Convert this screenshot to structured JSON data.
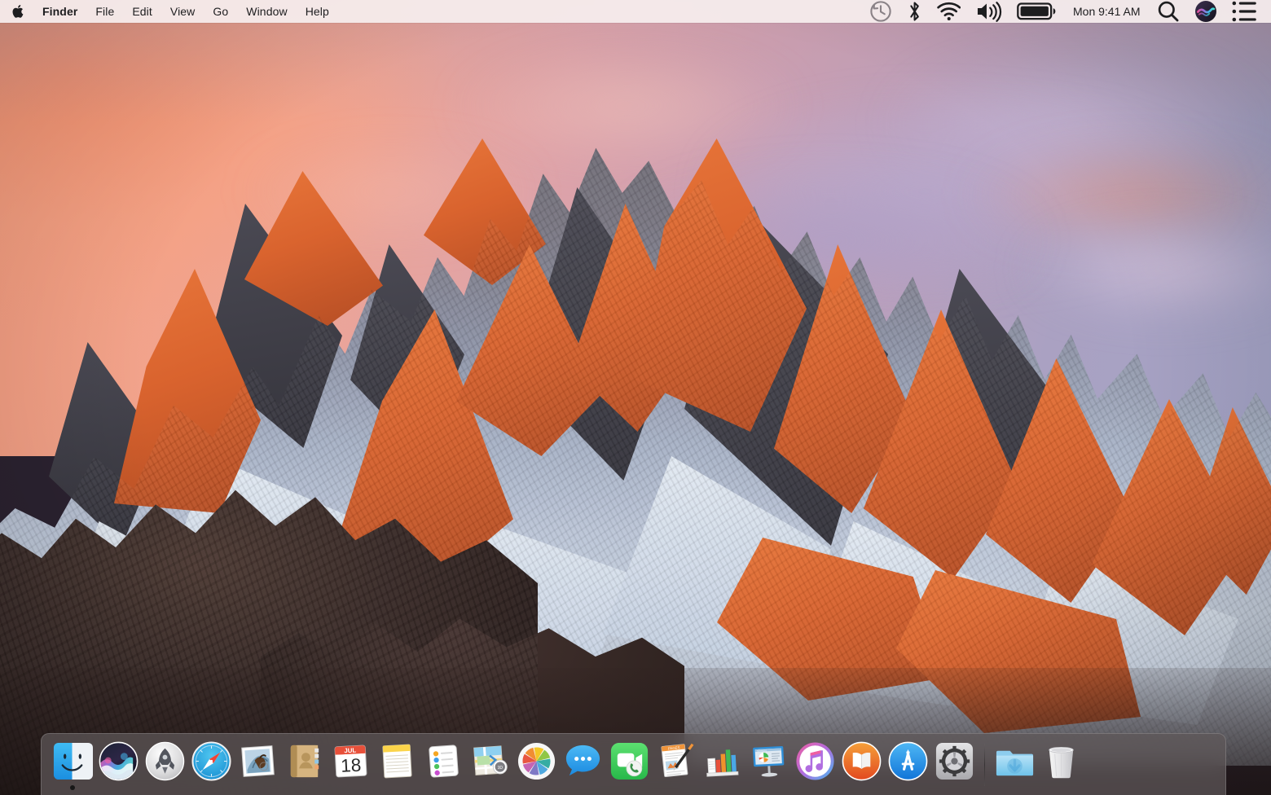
{
  "os": {
    "name": "macOS Sierra Desktop",
    "wallpaper_name": "Sierra (Lone Pine Peak)"
  },
  "menubar": {
    "apple_icon": "apple-logo-icon",
    "items": [
      {
        "label": "Finder",
        "bold": true
      },
      {
        "label": "File",
        "bold": false
      },
      {
        "label": "Edit",
        "bold": false
      },
      {
        "label": "View",
        "bold": false
      },
      {
        "label": "Go",
        "bold": false
      },
      {
        "label": "Window",
        "bold": false
      },
      {
        "label": "Help",
        "bold": false
      }
    ],
    "status_items": [
      {
        "name": "time-machine-icon",
        "label": "Time Machine"
      },
      {
        "name": "bluetooth-icon",
        "label": "Bluetooth"
      },
      {
        "name": "wifi-icon",
        "label": "Wi-Fi"
      },
      {
        "name": "volume-icon",
        "label": "Volume"
      },
      {
        "name": "battery-icon",
        "label": "Battery"
      }
    ],
    "clock": "Mon 9:41 AM",
    "spotlight_icon": "search-icon",
    "siri_icon": "siri-icon",
    "notification_center_icon": "notification-center-icon",
    "background_color": "#f6eeee",
    "text_color": "#1d1d1f"
  },
  "dock": {
    "background_color": "#5f595a",
    "items": [
      {
        "name": "finder",
        "label": "Finder",
        "running": true
      },
      {
        "name": "siri",
        "label": "Siri",
        "running": false
      },
      {
        "name": "launchpad",
        "label": "Launchpad",
        "running": false
      },
      {
        "name": "safari",
        "label": "Safari",
        "running": false
      },
      {
        "name": "mail",
        "label": "Mail",
        "running": false
      },
      {
        "name": "contacts",
        "label": "Contacts",
        "running": false
      },
      {
        "name": "calendar",
        "label": "Calendar",
        "running": false,
        "month": "JUL",
        "day": "18"
      },
      {
        "name": "notes",
        "label": "Notes",
        "running": false
      },
      {
        "name": "reminders",
        "label": "Reminders",
        "running": false
      },
      {
        "name": "maps",
        "label": "Maps",
        "running": false,
        "badge": "3D"
      },
      {
        "name": "photos",
        "label": "Photos",
        "running": false
      },
      {
        "name": "messages",
        "label": "Messages",
        "running": false
      },
      {
        "name": "facetime",
        "label": "FaceTime",
        "running": false
      },
      {
        "name": "pages",
        "label": "Pages",
        "running": false,
        "doc_label": "PAGES"
      },
      {
        "name": "numbers",
        "label": "Numbers",
        "running": false
      },
      {
        "name": "keynote",
        "label": "Keynote",
        "running": false,
        "doc_label": "KEYNOTE"
      },
      {
        "name": "itunes",
        "label": "iTunes",
        "running": false
      },
      {
        "name": "ibooks",
        "label": "iBooks",
        "running": false
      },
      {
        "name": "app-store",
        "label": "App Store",
        "running": false
      },
      {
        "name": "system-preferences",
        "label": "System Preferences",
        "running": false
      }
    ],
    "separator": true,
    "stack_items": [
      {
        "name": "downloads-folder",
        "label": "Downloads"
      },
      {
        "name": "trash",
        "label": "Trash"
      }
    ]
  }
}
